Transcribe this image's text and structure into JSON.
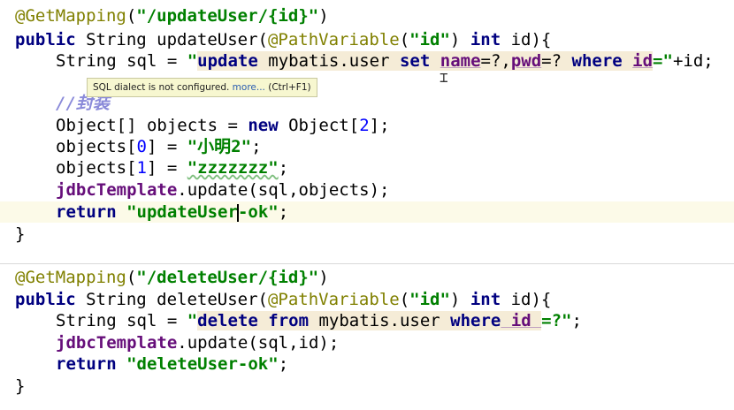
{
  "colors": {
    "annotation": "#808000",
    "keyword": "#000080",
    "string": "#008000",
    "number": "#0000ff",
    "comment": "#8a8ad9",
    "field": "#660e7a",
    "current_line": "#fcfae8",
    "sql_injection_bg": "#f5ecd7"
  },
  "update_method": {
    "annotation": "@GetMapping",
    "path": "\"/updateUser/{id}\"",
    "sig_public": "public",
    "sig_type": " String updateUser(",
    "sig_param_ann": "@PathVariable",
    "sig_param_name": "\"id\"",
    "sig_int": "int",
    "sig_end": " id){",
    "sql_decl": "String sql = ",
    "sql_open_quote": "\"",
    "sql_update": "update",
    "sql_table": " mybatis.user ",
    "sql_set": "set",
    "sql_col_name": "name",
    "sql_part_a": "=?,",
    "sql_col_pwd": "pwd",
    "sql_part_b": "=? ",
    "sql_where": "where",
    "sql_col_id": "id",
    "sql_close": "=\"",
    "sql_tail": "+id;",
    "comment": "//封装",
    "objects_decl_a": "Object[] objects = ",
    "objects_new": "new",
    "objects_decl_b": " Object[",
    "objects_size": "2",
    "objects_decl_c": "];",
    "obj0_a": "objects[",
    "obj0_idx": "0",
    "obj0_b": "] = ",
    "obj0_val": "\"小明2\"",
    "obj0_end": ";",
    "obj1_a": "objects[",
    "obj1_idx": "1",
    "obj1_b": "] = ",
    "obj1_val": "\"zzzzzzz\"",
    "obj1_end": ";",
    "update_field": "jdbcTemplate",
    "update_call": ".update(sql,objects);",
    "return_kw": "return",
    "return_val_a": "\"updateUser",
    "return_val_b": "-ok\"",
    "return_end": ";",
    "close_brace": "}"
  },
  "delete_method": {
    "annotation": "@GetMapping",
    "path": "\"/deleteUser/{id}\"",
    "sig_public": "public",
    "sig_type": " String deleteUser(",
    "sig_param_ann": "@PathVariable",
    "sig_param_name": "\"id\"",
    "sig_int": "int",
    "sig_end": " id){",
    "sql_decl": "String sql = ",
    "sql_open_quote": "\"",
    "sql_delete": "delete",
    "sql_from": " from",
    "sql_table": " mybatis.user ",
    "sql_where": "where",
    "sql_col_id": " id ",
    "sql_close": "=?\"",
    "sql_end": ";",
    "update_field": "jdbcTemplate",
    "update_call": ".update(sql,id);",
    "return_kw": "return",
    "return_val": "\"deleteUser-ok\"",
    "return_end": ";",
    "close_brace": "}"
  },
  "tooltip": {
    "text": "SQL dialect is not configured. ",
    "more": "more...",
    "shortcut": " (Ctrl+F1)"
  }
}
